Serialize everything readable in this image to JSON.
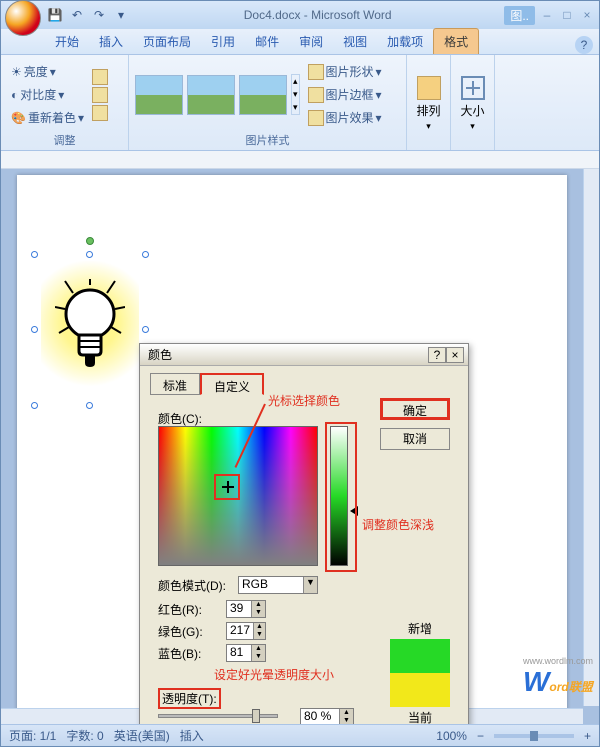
{
  "title": "Doc4.docx - Microsoft Word",
  "tool_context": "图..",
  "tabs": {
    "start": "开始",
    "insert": "插入",
    "layout": "页面布局",
    "ref": "引用",
    "mail": "邮件",
    "review": "审阅",
    "view": "视图",
    "addin": "加载项",
    "format": "格式"
  },
  "ribbon": {
    "adjust": {
      "title": "调整",
      "brightness": "亮度",
      "contrast": "对比度",
      "recolor": "重新着色"
    },
    "styles": {
      "title": "图片样式",
      "shape": "图片形状",
      "border": "图片边框",
      "effects": "图片效果"
    },
    "arrange": "排列",
    "size": "大小"
  },
  "dialog": {
    "title": "颜色",
    "tab_standard": "标准",
    "tab_custom": "自定义",
    "ok": "确定",
    "cancel": "取消",
    "color_label": "颜色(C):",
    "mode_label": "颜色模式(D):",
    "mode_value": "RGB",
    "red": "红色(R):",
    "red_v": "39",
    "green": "绿色(G):",
    "green_v": "217",
    "blue": "蓝色(B):",
    "blue_v": "81",
    "new": "新增",
    "current": "当前",
    "trans_label": "透明度(T):",
    "trans_value": "80 %"
  },
  "annotations": {
    "cursor": "光标选择颜色",
    "lum": "调整颜色深浅",
    "trans": "设定好光晕透明度大小"
  },
  "status": {
    "page": "页面: 1/1",
    "words": "字数: 0",
    "lang": "英语(美国)",
    "mode": "插入",
    "zoom": "100%"
  },
  "watermark": {
    "w": "W",
    "brand": "ord联盟",
    "url": "www.wordlm.com"
  }
}
